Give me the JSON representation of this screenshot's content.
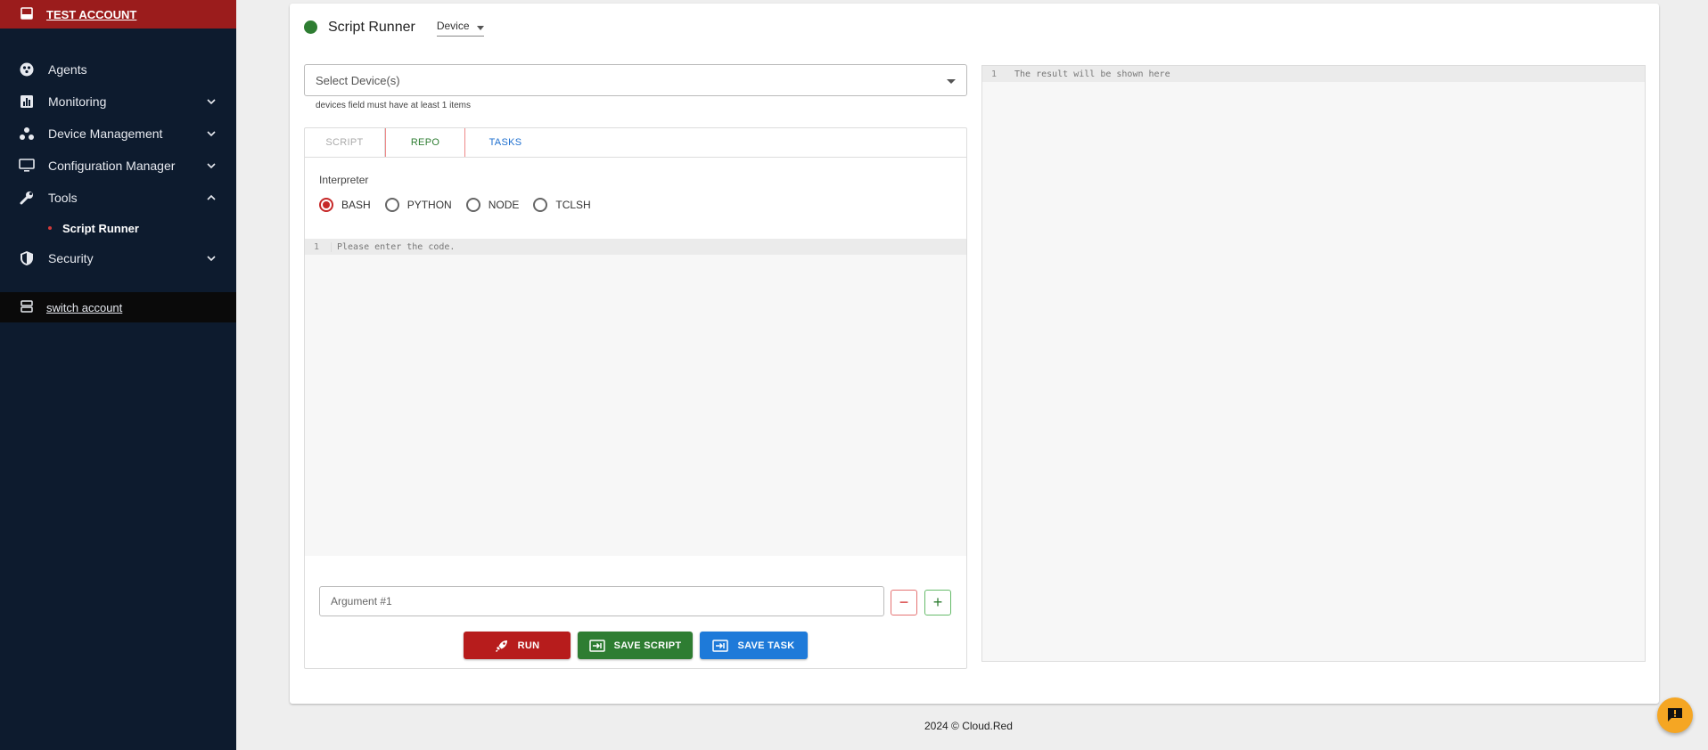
{
  "sidebar": {
    "account_label": "TEST ACCOUNT",
    "items": [
      {
        "label": "Agents",
        "icon": "agents-icon"
      },
      {
        "label": "Monitoring",
        "icon": "monitoring-icon"
      },
      {
        "label": "Device Management",
        "icon": "device-management-icon"
      },
      {
        "label": "Configuration Manager",
        "icon": "monitor-icon"
      },
      {
        "label": "Tools",
        "icon": "wrench-icon",
        "expanded": true
      },
      {
        "label": "Security",
        "icon": "shield-icon"
      }
    ],
    "sub_item": "Script Runner",
    "switch_label": "switch account"
  },
  "header": {
    "title": "Script Runner",
    "mode_value": "Device",
    "status_color": "#2e7d32"
  },
  "device_select": {
    "placeholder": "Select Device(s)",
    "helper": "devices field must have at least 1 items"
  },
  "tabs": [
    "SCRIPT",
    "REPO",
    "TASKS"
  ],
  "interpreter": {
    "label": "Interpreter",
    "options": [
      "BASH",
      "PYTHON",
      "NODE",
      "TCLSH"
    ],
    "selected": "BASH"
  },
  "editor": {
    "line_number": "1",
    "placeholder": "Please enter the code."
  },
  "arguments": {
    "placeholder": "Argument #1",
    "minus": "−",
    "plus": "+"
  },
  "actions": {
    "run": "RUN",
    "save_script": "SAVE SCRIPT",
    "save_task": "SAVE TASK"
  },
  "result": {
    "line_number": "1",
    "placeholder": "The result will be shown here"
  },
  "footer": {
    "text": "2024  © Cloud.Red"
  },
  "colors": {
    "sidebar_bg": "#0d1b2e",
    "account_bar": "#9b1c1c",
    "run": "#b71c1c",
    "save_script": "#2e7d32",
    "save_task": "#1e7ad9",
    "fab": "#f5a623"
  }
}
